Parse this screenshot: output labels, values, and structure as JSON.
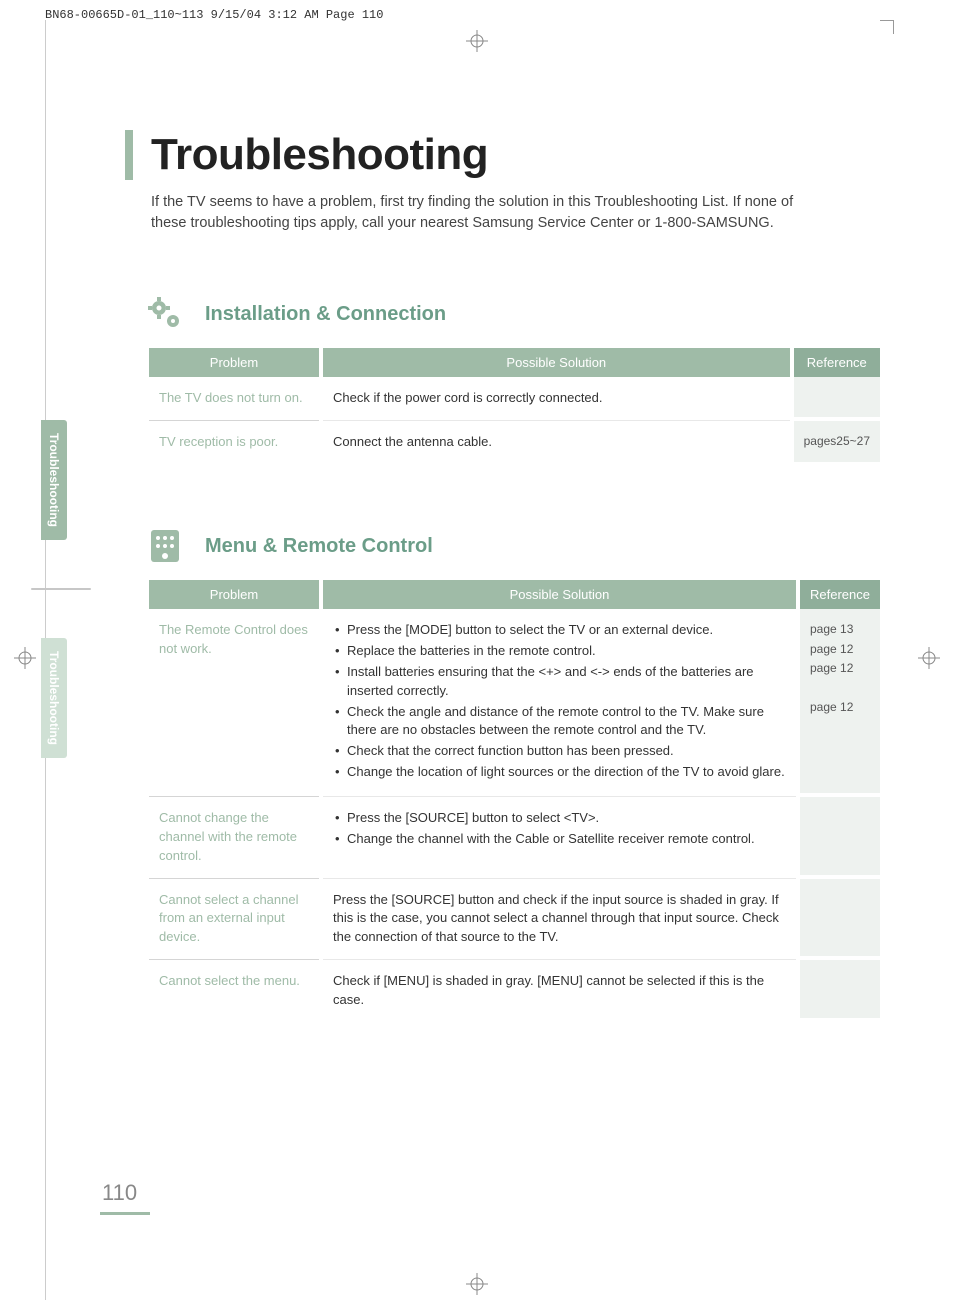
{
  "header_line": "BN68-00665D-01_110~113  9/15/04  3:12 AM  Page 110",
  "title": "Troubleshooting",
  "intro": "If the TV seems to have a problem, first try finding the solution in this Troubleshooting List. If none of these troubleshooting tips apply, call your nearest Samsung Service Center or 1-800-SAMSUNG.",
  "side_tabs": [
    "Troubleshooting",
    "Troubleshooting"
  ],
  "columns": {
    "problem": "Problem",
    "solution": "Possible Solution",
    "reference": "Reference"
  },
  "sections": [
    {
      "icon": "gears-icon",
      "title": "Installation & Connection",
      "rows": [
        {
          "problem": "The TV does not turn on.",
          "solution_type": "text",
          "solution": "Check if the power cord is correctly connected.",
          "reference": ""
        },
        {
          "problem": "TV reception is poor.",
          "solution_type": "text",
          "solution": "Connect the antenna cable.",
          "reference": "pages25~27"
        }
      ]
    },
    {
      "icon": "remote-icon",
      "title": "Menu & Remote Control",
      "rows": [
        {
          "problem": "The Remote Control does not work.",
          "solution_type": "list",
          "solution_items": [
            "Press the [MODE] button to select the TV or an external device.",
            "Replace the batteries in the remote control.",
            "Install batteries ensuring that the <+> and <-> ends of the batteries are inserted correctly.",
            "Check the angle and distance of the remote control to the TV. Make sure there are no obstacles between the remote control and the TV.",
            "Check that the correct function button has been pressed.",
            "Change the location of light sources or the direction of the TV to avoid glare."
          ],
          "references": [
            "page 13",
            "page 12",
            "page 12",
            "",
            "page 12"
          ]
        },
        {
          "problem": "Cannot change the channel with the remote control.",
          "solution_type": "list",
          "solution_items": [
            "Press the [SOURCE] button to select <TV>.",
            "Change the channel with the Cable or Satellite receiver remote control."
          ],
          "reference": ""
        },
        {
          "problem": "Cannot select a channel from an external input device.",
          "solution_type": "text",
          "solution": "Press the [SOURCE] button and check if the input source is shaded in gray. If this is the case, you cannot select a channel through that input source. Check the connection of that source to the TV.",
          "reference": ""
        },
        {
          "problem": "Cannot select the menu.",
          "solution_type": "text",
          "solution": "Check if [MENU] is shaded in gray. [MENU] cannot be selected if this is the case.",
          "reference": ""
        }
      ]
    }
  ],
  "page_number": "110"
}
